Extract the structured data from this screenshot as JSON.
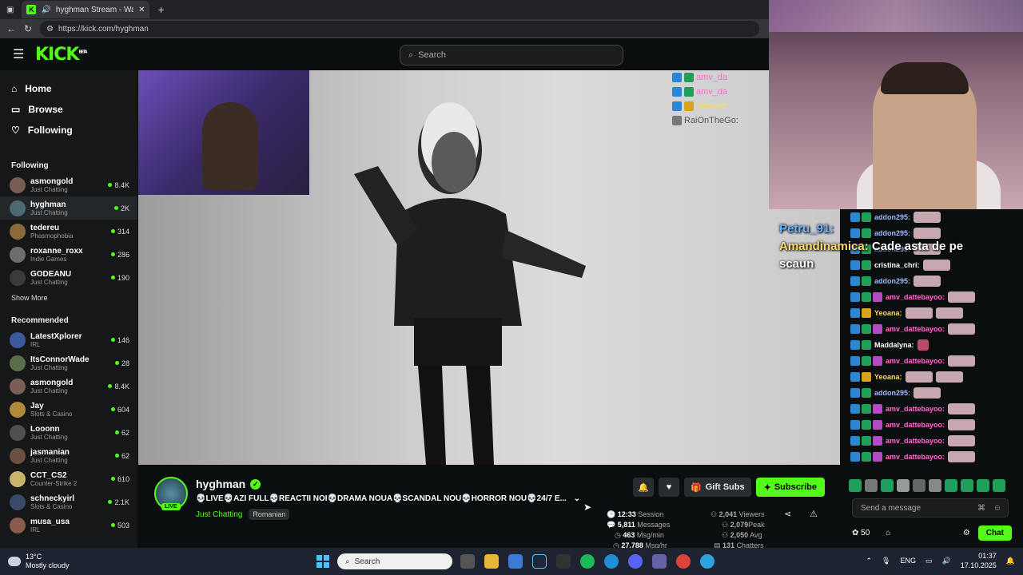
{
  "browser": {
    "tab_title": "hyghman Stream - Watch Li...",
    "new_tab": "+",
    "url": "https://kick.com/hyghman"
  },
  "topnav": {
    "logo": "KICK",
    "logo_badge": "BETA",
    "search_placeholder": "Search"
  },
  "sidebar": {
    "nav": [
      {
        "label": "Home"
      },
      {
        "label": "Browse"
      },
      {
        "label": "Following"
      }
    ],
    "following_title": "Following",
    "following": [
      {
        "name": "asmongold",
        "category": "Just Chatting",
        "viewers": "8.4K"
      },
      {
        "name": "hyghman",
        "category": "Just Chatting",
        "viewers": "2K"
      },
      {
        "name": "tedereu",
        "category": "Phasmophobia",
        "viewers": "314"
      },
      {
        "name": "roxanne_roxx",
        "category": "Indie Games",
        "viewers": "286"
      },
      {
        "name": "GODEANU",
        "category": "Just Chatting",
        "viewers": "190"
      }
    ],
    "show_more": "Show More",
    "recommended_title": "Recommended",
    "recommended": [
      {
        "name": "LatestXplorer",
        "category": "IRL",
        "viewers": "146"
      },
      {
        "name": "ItsConnorWade",
        "category": "Just Chatting",
        "viewers": "28"
      },
      {
        "name": "asmongold",
        "category": "Just Chatting",
        "viewers": "8.4K"
      },
      {
        "name": "Jay",
        "category": "Slots & Casino",
        "viewers": "604"
      },
      {
        "name": "Looonn",
        "category": "Just Chatting",
        "viewers": "62"
      },
      {
        "name": "jasmanian",
        "category": "Just Chatting",
        "viewers": "62"
      },
      {
        "name": "CCT_CS2",
        "category": "Counter-Strike 2",
        "viewers": "610"
      },
      {
        "name": "schneckyirl",
        "category": "Slots & Casino",
        "viewers": "2.1K"
      },
      {
        "name": "musa_usa",
        "category": "IRL",
        "viewers": "503"
      }
    ]
  },
  "overlay_chat": [
    {
      "user": "amv_da"
    },
    {
      "user": "amv_da"
    },
    {
      "user": "Yeoana:"
    },
    {
      "user": "RaiOnTheGo:"
    }
  ],
  "stream": {
    "name": "hyghman",
    "live": "LIVE",
    "title": "💀LIVE💀AZI FULL💀REACTII NOI💀DRAMA NOUA💀SCANDAL NOU💀HORROR NOU💀24/7 E...",
    "category": "Just Chatting",
    "tag": "Romanian",
    "gift_label": "Gift Subs",
    "subscribe_label": "Subscribe",
    "stats": {
      "session": "12:33",
      "session_label": "Session",
      "messages": "5,811",
      "messages_label": "Messages",
      "msg_min": "463",
      "msg_min_label": "Msg/min",
      "msg_hr": "27,788",
      "msg_hr_label": "Msg/hr",
      "viewers": "2,041",
      "viewers_label": "Viewers",
      "peak": "2,079",
      "peak_label": "Peak",
      "avg": "2,050",
      "avg_label": "Avg",
      "chatters": "131",
      "chatters_label": "Chatters"
    }
  },
  "big_chat": {
    "user1": "Petru_91:",
    "user2": "Amandinamica:",
    "message": "Cade asta de pe scaun"
  },
  "chat": [
    {
      "user": "addon295:",
      "color": "#9fb8ff"
    },
    {
      "user": "addon295:",
      "color": "#9fb8ff"
    },
    {
      "user": "addon295:",
      "color": "#9fb8ff"
    },
    {
      "user": "cristina_chri:",
      "color": "#ffffff"
    },
    {
      "user": "addon295:",
      "color": "#9fb8ff"
    },
    {
      "user": "amv_dattebayoo:",
      "color": "#ff6ad5"
    },
    {
      "user": "Yeoana:",
      "color": "#ffd86b"
    },
    {
      "user": "amv_dattebayoo:",
      "color": "#ff6ad5"
    },
    {
      "user": "Maddalyna:",
      "color": "#ffffff"
    },
    {
      "user": "amv_dattebayoo:",
      "color": "#ff6ad5"
    },
    {
      "user": "Yeoana:",
      "color": "#ffd86b"
    },
    {
      "user": "addon295:",
      "color": "#9fb8ff"
    },
    {
      "user": "amv_dattebayoo:",
      "color": "#ff6ad5"
    },
    {
      "user": "amv_dattebayoo:",
      "color": "#ff6ad5"
    },
    {
      "user": "amv_dattebayoo:",
      "color": "#ff6ad5"
    },
    {
      "user": "amv_dattebayoo:",
      "color": "#ff6ad5"
    }
  ],
  "chat_input": {
    "placeholder": "Send a message",
    "points": "50",
    "send_label": "Chat"
  },
  "taskbar": {
    "temp": "13°C",
    "weather": "Mostly cloudy",
    "search": "Search",
    "lang": "ENG",
    "time": "01:37",
    "date": "17.10.2025"
  },
  "colors": {
    "accent": "#53fc18",
    "bg": "#0b0e0f",
    "sidebar": "#151718"
  }
}
